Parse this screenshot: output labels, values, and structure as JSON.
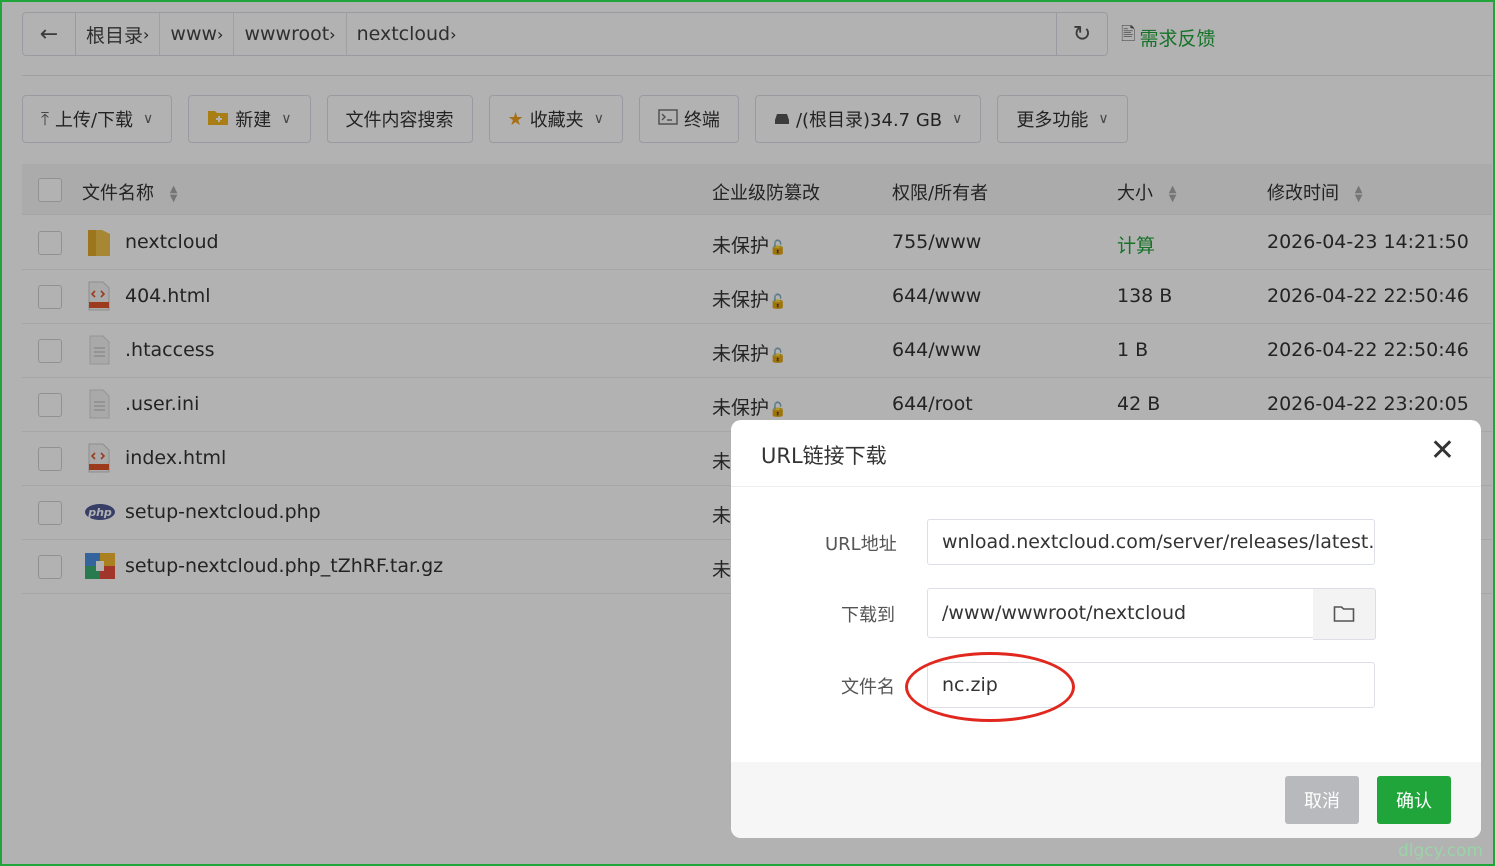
{
  "pathbar": {
    "crumbs": [
      "根目录",
      "www",
      "wwwroot",
      "nextcloud"
    ],
    "feedback_label": "需求反馈"
  },
  "toolbar": {
    "upload": "上传/下载",
    "new": "新建",
    "search": "文件内容搜索",
    "favorites": "收藏夹",
    "terminal": "终端",
    "disk": "/(根目录)34.7 GB",
    "more": "更多功能"
  },
  "table": {
    "headers": {
      "name": "文件名称",
      "protect": "企业级防篡改",
      "perm": "权限/所有者",
      "size": "大小",
      "mtime": "修改时间"
    },
    "rows": [
      {
        "name": "nextcloud",
        "icon": "folder-icon",
        "protect": "未保护",
        "perm": "755/www",
        "size": "计算",
        "mtime": "2026-04-23 14:21:50"
      },
      {
        "name": "404.html",
        "icon": "html-file-icon",
        "protect": "未保护",
        "perm": "644/www",
        "size": "138 B",
        "mtime": "2026-04-22 22:50:46"
      },
      {
        "name": ".htaccess",
        "icon": "text-file-icon",
        "protect": "未保护",
        "perm": "644/www",
        "size": "1 B",
        "mtime": "2026-04-22 22:50:46"
      },
      {
        "name": ".user.ini",
        "icon": "text-file-icon",
        "protect": "未保护",
        "perm": "644/root",
        "size": "42 B",
        "mtime": "2026-04-22 23:20:05"
      },
      {
        "name": "index.html",
        "icon": "html-file-icon",
        "protect": "未",
        "perm": "",
        "size": "",
        "mtime": ""
      },
      {
        "name": "setup-nextcloud.php",
        "icon": "php-file-icon",
        "protect": "未",
        "perm": "",
        "size": "",
        "mtime": ""
      },
      {
        "name": "setup-nextcloud.php_tZhRF.tar.gz",
        "icon": "archive-file-icon",
        "protect": "未",
        "perm": "",
        "size": "",
        "mtime": ""
      }
    ]
  },
  "modal": {
    "title": "URL链接下载",
    "url_label": "URL地址",
    "url_value": "wnload.nextcloud.com/server/releases/latest.zip",
    "dest_label": "下载到",
    "dest_value": "/www/wwwroot/nextcloud",
    "filename_label": "文件名",
    "filename_value": "nc.zip",
    "cancel_label": "取消",
    "ok_label": "确认"
  },
  "watermark": "dlgcy.com",
  "colors": {
    "accent": "#20a53a",
    "annotation": "#e0281e",
    "size_link": "#20a53a"
  }
}
